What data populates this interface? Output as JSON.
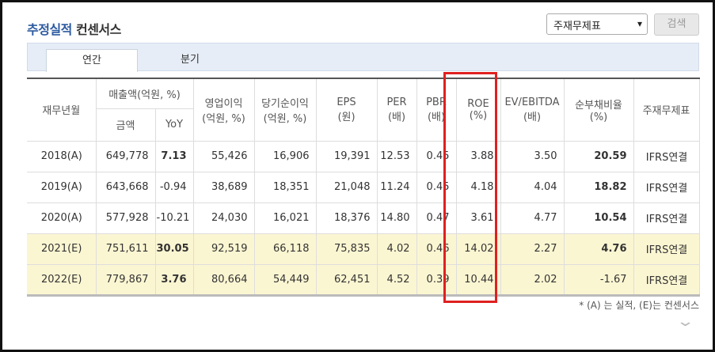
{
  "title": {
    "part1": "추정실적",
    "part2": "컨센서스"
  },
  "controls": {
    "select_value": "주재무제표",
    "select_arrow": "▾",
    "search_label": "검색"
  },
  "tabs": [
    {
      "label": "연간"
    },
    {
      "label": "분기"
    }
  ],
  "headers": {
    "period": "재무년월",
    "sales_group": "매출액(억원, %)",
    "sales_amount": "금액",
    "sales_yoy": "YoY",
    "op_income": "영업이익",
    "op_income_unit": "(억원, %)",
    "net_income": "당기순이익",
    "net_income_unit": "(억원, %)",
    "eps": "EPS",
    "eps_unit": "(원)",
    "per": "PER",
    "per_unit": "(배)",
    "pbr": "PBR",
    "pbr_unit": "(배)",
    "roe": "ROE",
    "roe_unit": "(%)",
    "ev": "EV/EBITDA",
    "ev_unit": "(배)",
    "debt": "순부채비율",
    "debt_unit": "(%)",
    "stmt": "주재무제표"
  },
  "rows": [
    {
      "period": "2018(A)",
      "sales": "649,778",
      "yoy": "7.13",
      "op": "55,426",
      "net": "16,906",
      "eps": "19,391",
      "per": "12.53",
      "pbr": "0.45",
      "roe": "3.88",
      "ev": "3.50",
      "debt": "20.59",
      "stmt": "IFRS연결"
    },
    {
      "period": "2019(A)",
      "sales": "643,668",
      "yoy": "-0.94",
      "op": "38,689",
      "net": "18,351",
      "eps": "21,048",
      "per": "11.24",
      "pbr": "0.45",
      "roe": "4.18",
      "ev": "4.04",
      "debt": "18.82",
      "stmt": "IFRS연결"
    },
    {
      "period": "2020(A)",
      "sales": "577,928",
      "yoy": "-10.21",
      "op": "24,030",
      "net": "16,021",
      "eps": "18,376",
      "per": "14.80",
      "pbr": "0.47",
      "roe": "3.61",
      "ev": "4.77",
      "debt": "10.54",
      "stmt": "IFRS연결"
    },
    {
      "period": "2021(E)",
      "sales": "751,611",
      "yoy": "30.05",
      "op": "92,519",
      "net": "66,118",
      "eps": "75,835",
      "per": "4.02",
      "pbr": "0.46",
      "roe": "14.02",
      "ev": "2.27",
      "debt": "4.76",
      "stmt": "IFRS연결"
    },
    {
      "period": "2022(E)",
      "sales": "779,867",
      "yoy": "3.76",
      "op": "80,664",
      "net": "54,449",
      "eps": "62,451",
      "per": "4.52",
      "pbr": "0.39",
      "roe": "10.44",
      "ev": "2.02",
      "debt": "-1.67",
      "stmt": "IFRS연결"
    }
  ],
  "note": "* (A) 는 실적, (E)는 컨센서스",
  "colors": {
    "negative": "#d23434",
    "estimate_bg": "#fbf6d2",
    "highlight": "#e02020",
    "title_blue": "#2c5aa0"
  }
}
